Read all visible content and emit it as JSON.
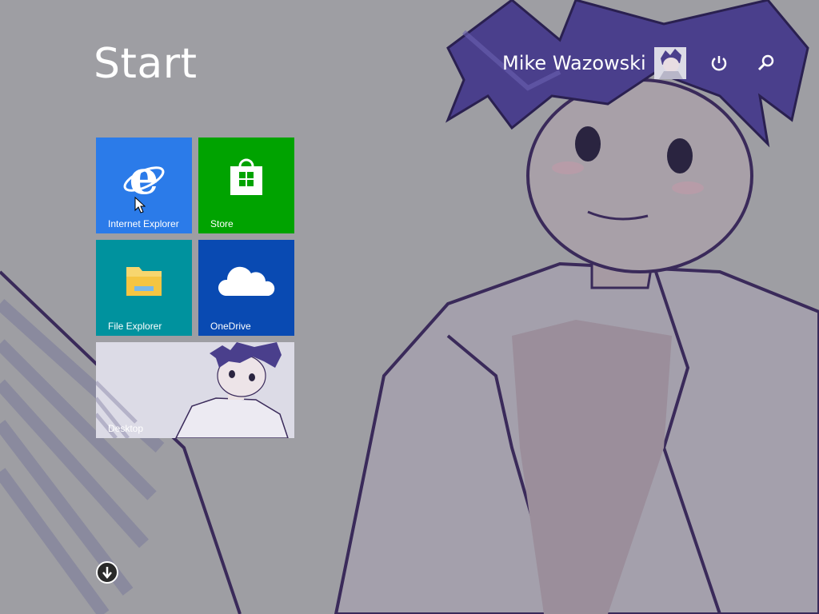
{
  "screen": {
    "title": "Start",
    "background_color": "#9e9ea3",
    "wallpaper": "illustration-of-dark-haired-character-in-striped-shirt"
  },
  "user": {
    "name": "Mike Wazowski",
    "avatar_icon": "user-avatar-illustration"
  },
  "top_actions": [
    {
      "name": "power",
      "icon": "power-icon"
    },
    {
      "name": "search",
      "icon": "search-icon"
    }
  ],
  "tiles": [
    {
      "id": "ie",
      "label": "Internet Explorer",
      "icon": "internet-explorer-icon",
      "color": "#2b7be9"
    },
    {
      "id": "store",
      "label": "Store",
      "icon": "store-bag-icon",
      "color": "#00a300"
    },
    {
      "id": "explorer",
      "label": "File Explorer",
      "icon": "folder-icon",
      "color": "#00929e"
    },
    {
      "id": "onedrive",
      "label": "OneDrive",
      "icon": "cloud-icon",
      "color": "#094ab2"
    },
    {
      "id": "desktop",
      "label": "Desktop",
      "icon": "desktop-wallpaper-preview",
      "color": "#dcdbe6"
    }
  ],
  "apps_button": {
    "icon": "arrow-down-circle-icon"
  }
}
